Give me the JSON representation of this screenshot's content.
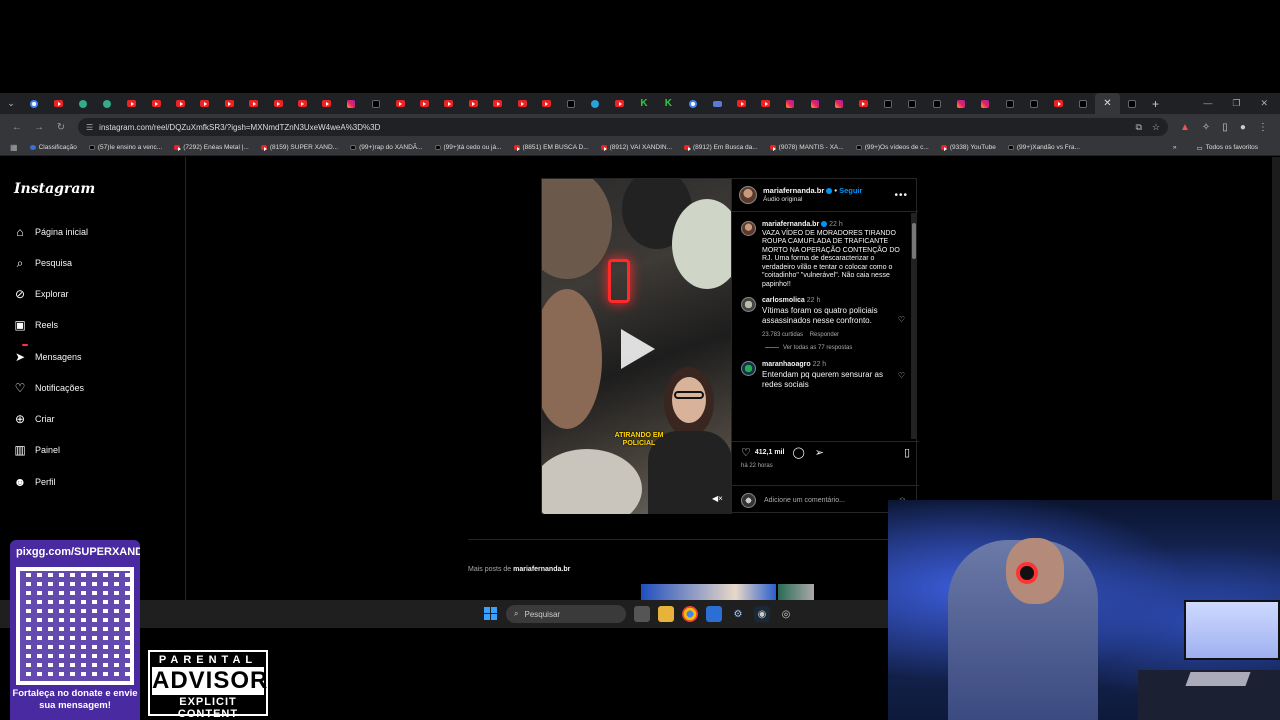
{
  "browser": {
    "url": "instagram.com/reel/DQZuXmfkSR3/?igsh=MXNmdTZnN3UxeW4weA%3D%3D",
    "tabs": [
      "gl",
      "yt",
      "gr",
      "gr",
      "yt",
      "yt",
      "yt",
      "yt",
      "yt",
      "yt",
      "yt",
      "yt",
      "yt",
      "ig",
      "tk",
      "yt",
      "yt",
      "yt",
      "yt",
      "yt",
      "yt",
      "yt",
      "tk",
      "tg",
      "yt",
      "kk",
      "kk",
      "gl",
      "ms",
      "yt",
      "yt",
      "ig",
      "ig",
      "ig",
      "yt",
      "tk",
      "tk",
      "tk",
      "ig",
      "ig",
      "tk",
      "tk",
      "yt",
      "tk",
      "active",
      "tk"
    ],
    "bookmarks": [
      {
        "label": "Classificação",
        "icon": "bl"
      },
      {
        "label": "(57)Ie ensino a venc...",
        "icon": "tk"
      },
      {
        "label": "(7292) Enéas Metal |...",
        "icon": "yt"
      },
      {
        "label": "(8159) SUPER XAND...",
        "icon": "yt"
      },
      {
        "label": "(99+)rap do XANDÃ...",
        "icon": "tk"
      },
      {
        "label": "(99+)tá cedo ou já...",
        "icon": "tk"
      },
      {
        "label": "(8851) EM BUSCA D...",
        "icon": "yt"
      },
      {
        "label": "(8912) VAI XANDIN...",
        "icon": "yt"
      },
      {
        "label": "(8912) Em Busca da...",
        "icon": "yt"
      },
      {
        "label": "(9078) MANTIS - XA...",
        "icon": "yt"
      },
      {
        "label": "(99+)Os vídeos de c...",
        "icon": "tk"
      },
      {
        "label": "(9338) YouTube",
        "icon": "yt"
      },
      {
        "label": "(99+)Xandão vs Fra...",
        "icon": "tk"
      }
    ],
    "all_bookmarks": "Todos os favoritos"
  },
  "instagram": {
    "logo": "Instagram",
    "nav": [
      {
        "label": "Página inicial",
        "icon": "home-icon",
        "glyph": "⌂"
      },
      {
        "label": "Pesquisa",
        "icon": "search-icon",
        "glyph": "⌕"
      },
      {
        "label": "Explorar",
        "icon": "compass-icon",
        "glyph": "⊘"
      },
      {
        "label": "Reels",
        "icon": "reels-icon",
        "glyph": "▣"
      },
      {
        "label": "Mensagens",
        "icon": "messenger-icon",
        "glyph": "➤"
      },
      {
        "label": "Notificações",
        "icon": "heart-icon",
        "glyph": "♡"
      },
      {
        "label": "Criar",
        "icon": "plus-icon",
        "glyph": "⊕"
      },
      {
        "label": "Painel",
        "icon": "dashboard-icon",
        "glyph": "▥"
      },
      {
        "label": "Perfil",
        "icon": "profile-icon",
        "glyph": "☻"
      }
    ],
    "messages_badge": "",
    "post": {
      "username": "mariafernanda.br",
      "follow": "Seguir",
      "audio": "Áudio original",
      "overlay_text": "ATIRANDO EM POLICIAL",
      "caption_user": "mariafernanda.br",
      "caption_time": "22 h",
      "caption": "VAZA VÍDEO DE MORADORES TIRANDO ROUPA CAMUFLADA DE TRAFICANTE MORTO NA OPERAÇÃO CONTENÇÃO DO RJ. Uma forma de descaracterizar o verdadeiro vilão e tentar o colocar como o \"coitadinho\" \"vulnerável\". Não caia nesse papinho!!",
      "comments": [
        {
          "user": "carlosmolica",
          "time": "22 h",
          "text": "Vítimas foram os quatro policiais assassinados nesse confronto.",
          "likes": "23.783 curtidas",
          "reply": "Responder",
          "view_replies": "Ver todas as 77 respostas"
        },
        {
          "user": "maranhaoagro",
          "time": "22 h",
          "text": "Entendam pq querem sensurar as redes sociais"
        }
      ],
      "like_count": "412,1 mil",
      "posted": "há 22 horas",
      "add_comment": "Adicione um comentário..."
    },
    "more_posts_prefix": "Mais posts de",
    "more_posts_user": "mariafernanda.br"
  },
  "taskbar": {
    "search": "Pesquisar"
  },
  "overlay": {
    "donate_url": "pixgg.com/SUPERXAND",
    "donate_text": "Fortaleça no donate e envie sua mensagem!",
    "parental_line1": "PARENTAL",
    "parental_line2": "ADVISORY",
    "parental_line3": "EXPLICIT CONTENT"
  }
}
